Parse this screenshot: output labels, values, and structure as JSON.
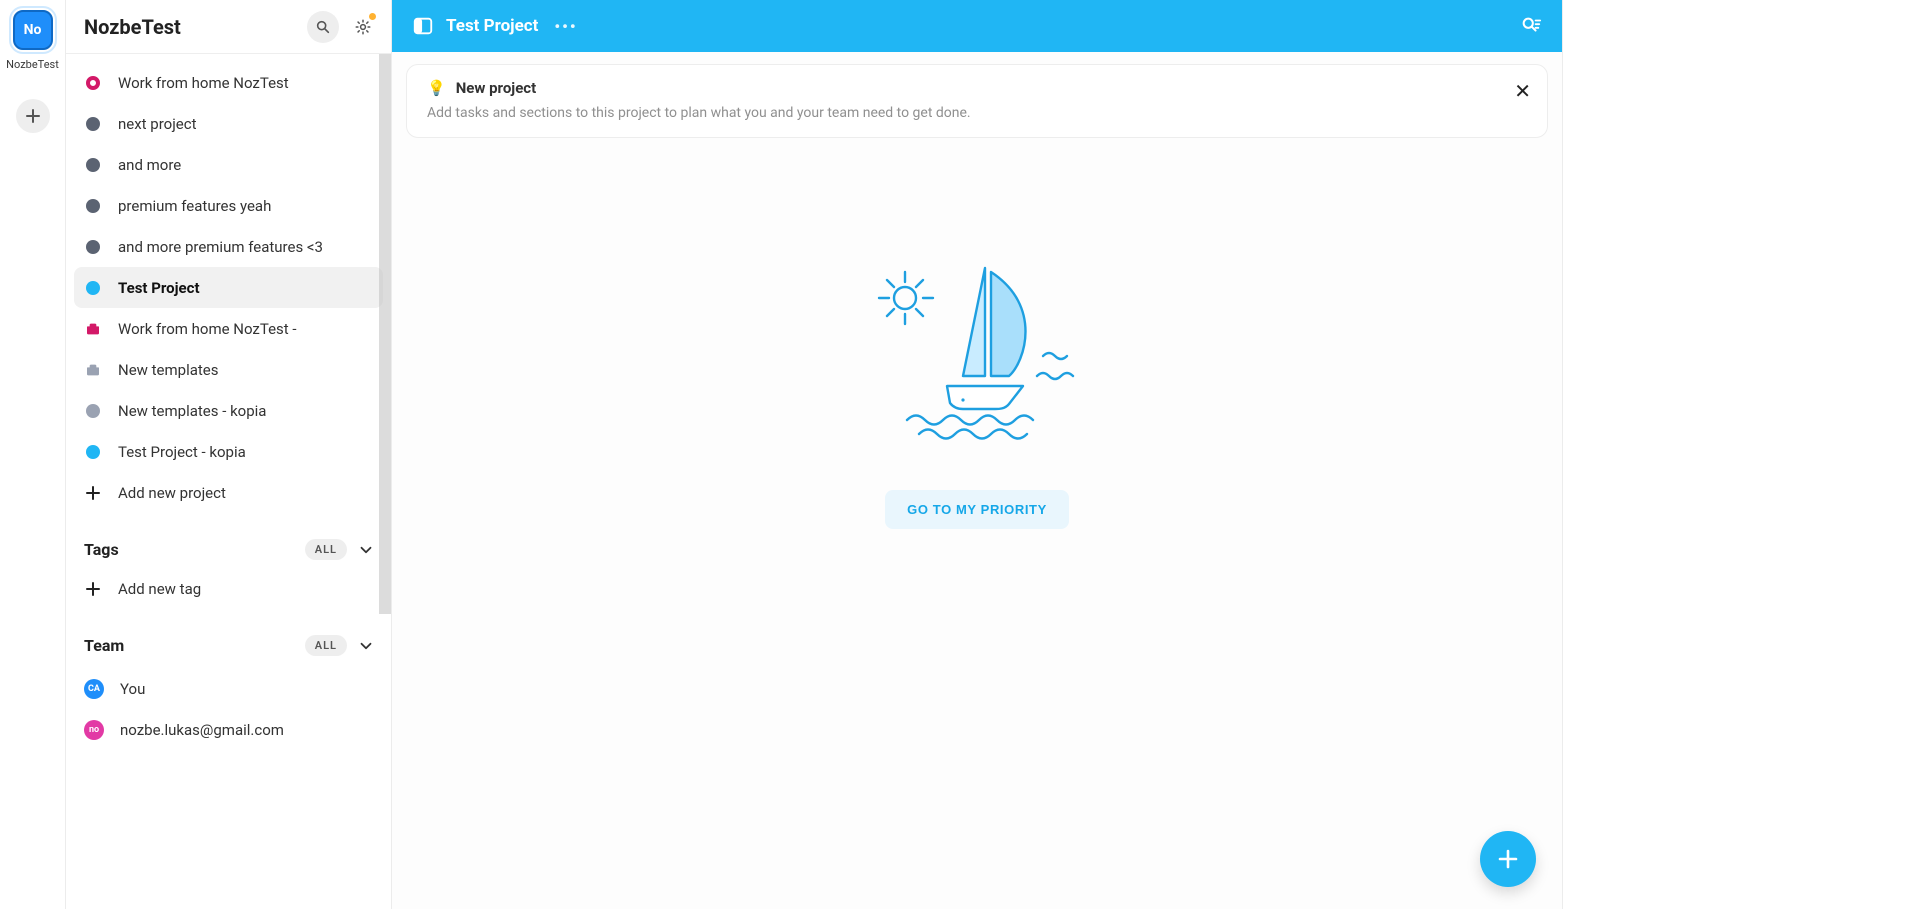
{
  "workspace": {
    "badge_text": "No",
    "label": "NozbeTest"
  },
  "sidebar": {
    "title": "NozbeTest",
    "projects": [
      {
        "label": "Work from home NozTest",
        "kind": "dot-ring",
        "color": "#d31968"
      },
      {
        "label": "next project",
        "kind": "dot",
        "color": "#5b6372"
      },
      {
        "label": "and more",
        "kind": "dot",
        "color": "#5b6372"
      },
      {
        "label": "premium features yeah",
        "kind": "dot",
        "color": "#5b6372"
      },
      {
        "label": "and more premium features <3",
        "kind": "dot",
        "color": "#5b6372"
      },
      {
        "label": "Test Project",
        "kind": "dot",
        "color": "#20b6f4",
        "selected": true
      },
      {
        "label": "Work from home NozTest -",
        "kind": "briefcase",
        "color": "#d31968"
      },
      {
        "label": "New templates",
        "kind": "briefcase",
        "color": "#9aa2b2"
      },
      {
        "label": "New templates - kopia",
        "kind": "dot",
        "color": "#9aa2b2"
      },
      {
        "label": "Test Project - kopia",
        "kind": "dot",
        "color": "#20b6f4"
      }
    ],
    "add_project_label": "Add new project",
    "tags": {
      "title": "Tags",
      "pill": "ALL",
      "add_label": "Add new tag"
    },
    "team": {
      "title": "Team",
      "pill": "ALL",
      "members": [
        {
          "label": "You",
          "avatar_bg": "#1f8efa",
          "avatar_text": "CA"
        },
        {
          "label": "nozbe.lukas@gmail.com",
          "avatar_bg": "#e23aa5",
          "avatar_text": "no"
        }
      ]
    }
  },
  "topbar": {
    "title": "Test Project"
  },
  "tip": {
    "title": "New project",
    "body": "Add tasks and sections to this project to plan what you and your team need to get done."
  },
  "empty": {
    "button_label": "GO TO MY PRIORITY"
  }
}
